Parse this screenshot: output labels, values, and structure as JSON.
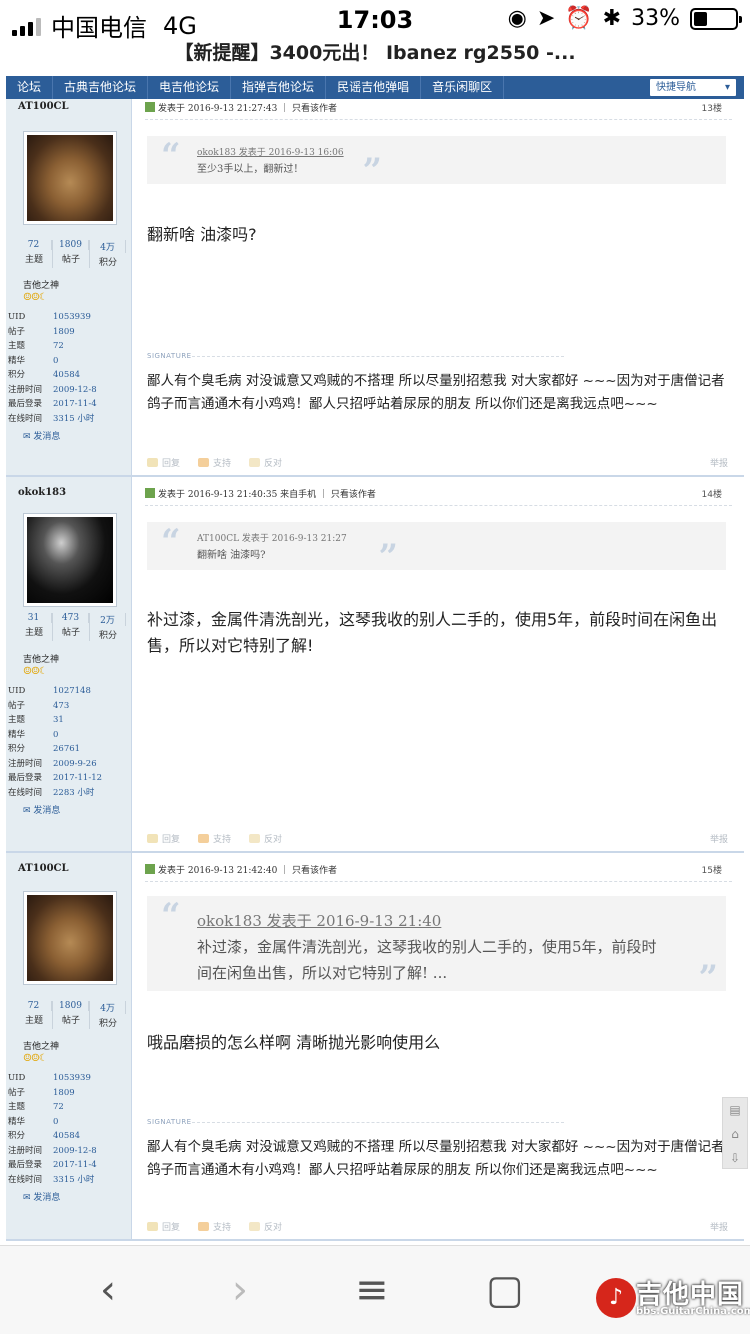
{
  "status": {
    "carrier": "中国电信",
    "network": "4G",
    "time": "17:03",
    "battery": "33%",
    "battery_level": 0.33
  },
  "url_title": "【新提醒】3400元出！ Ibanez rg2550 -...",
  "nav": {
    "items": [
      "论坛",
      "古典吉他论坛",
      "电吉他论坛",
      "指弹吉他论坛",
      "民谣吉他弹唱",
      "音乐闲聊区"
    ],
    "quick": "快捷导航"
  },
  "posts": [
    {
      "user": "AT100CL",
      "stats": {
        "topics": "72",
        "posts": "1809",
        "points": "4万"
      },
      "labels": {
        "topics": "主题",
        "posts": "帖子",
        "points": "积分"
      },
      "rank": "吉他之神",
      "info": [
        {
          "k": "UID",
          "v": "1053939"
        },
        {
          "k": "帖子",
          "v": "1809"
        },
        {
          "k": "主题",
          "v": "72"
        },
        {
          "k": "精华",
          "v": "0"
        },
        {
          "k": "积分",
          "v": "40584"
        },
        {
          "k": "注册时间",
          "v": "2009-12-8"
        },
        {
          "k": "最后登录",
          "v": "2017-11-4"
        },
        {
          "k": "在线时间",
          "v": "3315 小时"
        }
      ],
      "send_msg": "发消息",
      "header": "发表于 2016-9-13 21:27:43 ｜ 只看该作者",
      "floor": "13楼",
      "quote_author": "okok183 发表于 2016-9-13 16:06",
      "quote_text": "至少3手以上，翻新过！",
      "body": "翻新啥  油漆吗?",
      "sig_label": "SIGNATURE",
      "signature": "鄙人有个臭毛病 对没诚意又鸡贼的不搭理 所以尽量别招惹我 对大家都好  ~~~因为对于唐僧记者鸽子而言通通木有小鸡鸡！鄙人只招呼站着尿尿的朋友 所以你们还是离我远点吧~~~",
      "actions": {
        "reply": "回复",
        "support": "支持",
        "oppose": "反对",
        "report": "举报"
      }
    },
    {
      "user": "okok183",
      "stats": {
        "topics": "31",
        "posts": "473",
        "points": "2万"
      },
      "labels": {
        "topics": "主题",
        "posts": "帖子",
        "points": "积分"
      },
      "rank": "吉他之神",
      "info": [
        {
          "k": "UID",
          "v": "1027148"
        },
        {
          "k": "帖子",
          "v": "473"
        },
        {
          "k": "主题",
          "v": "31"
        },
        {
          "k": "精华",
          "v": "0"
        },
        {
          "k": "积分",
          "v": "26761"
        },
        {
          "k": "注册时间",
          "v": "2009-9-26"
        },
        {
          "k": "最后登录",
          "v": "2017-11-12"
        },
        {
          "k": "在线时间",
          "v": "2283 小时"
        }
      ],
      "send_msg": "发消息",
      "header": "发表于 2016-9-13 21:40:35 来自手机 ｜ 只看该作者",
      "floor": "14楼",
      "quote_author": "AT100CL 发表于 2016-9-13 21:27",
      "quote_text": "翻新啥  油漆吗?",
      "body": "补过漆，金属件清洗剖光，这琴我收的别人二手的，使用5年，前段时间在闲鱼出售，所以对它特别了解!",
      "actions": {
        "reply": "回复",
        "support": "支持",
        "oppose": "反对",
        "report": "举报"
      }
    },
    {
      "user": "AT100CL",
      "stats": {
        "topics": "72",
        "posts": "1809",
        "points": "4万"
      },
      "labels": {
        "topics": "主题",
        "posts": "帖子",
        "points": "积分"
      },
      "rank": "吉他之神",
      "info": [
        {
          "k": "UID",
          "v": "1053939"
        },
        {
          "k": "帖子",
          "v": "1809"
        },
        {
          "k": "主题",
          "v": "72"
        },
        {
          "k": "精华",
          "v": "0"
        },
        {
          "k": "积分",
          "v": "40584"
        },
        {
          "k": "注册时间",
          "v": "2009-12-8"
        },
        {
          "k": "最后登录",
          "v": "2017-11-4"
        },
        {
          "k": "在线时间",
          "v": "3315 小时"
        }
      ],
      "send_msg": "发消息",
      "header": "发表于 2016-9-13 21:42:40 ｜ 只看该作者",
      "floor": "15楼",
      "quote_author": "okok183 发表于 2016-9-13 21:40",
      "quote_text": "补过漆，金属件清洗剖光，这琴我收的别人二手的，使用5年，前段时间在闲鱼出售，所以对它特别了解! ...",
      "body": "哦品磨损的怎么样啊  清晰抛光影响使用么",
      "sig_label": "SIGNATURE",
      "signature": "鄙人有个臭毛病 对没诚意又鸡贼的不搭理 所以尽量别招惹我 对大家都好  ~~~因为对于唐僧记者鸽子而言通通木有小鸡鸡！鄙人只招呼站着尿尿的朋友 所以你们还是离我远点吧~~~",
      "actions": {
        "reply": "回复",
        "support": "支持",
        "oppose": "反对",
        "report": "举报"
      }
    }
  ],
  "toolbar": {
    "back": "‹",
    "forward": "›",
    "menu": "≡",
    "tabs": "▢",
    "logo_text": "吉他中国",
    "logo_url": "bbs.GuitarChina.com"
  }
}
